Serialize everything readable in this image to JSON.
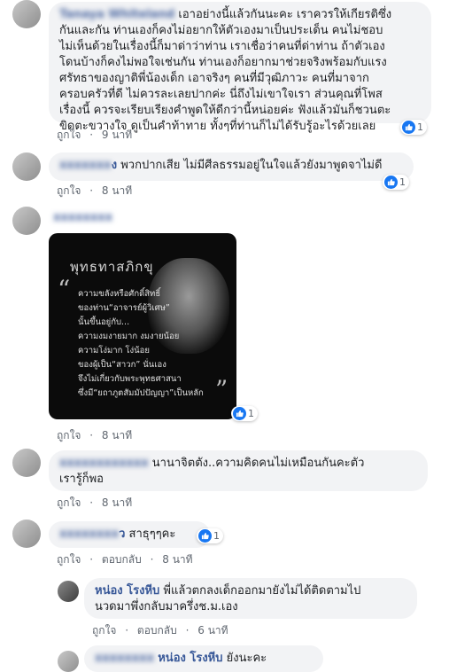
{
  "comments": [
    {
      "name": "Tanaya Whiteland",
      "lines": [
        "เอาอย่างนี้แล้วกันนะคะ เราควรให้เกียรติซึ่ง",
        "กันและกัน ท่านเองก็คงไม่อยากให้ตัวเองมาเป็นประเด็น คนไม่ชอบ",
        "ไม่เห็นด้วยในเรื่องนี้ก็มาด่าว่าท่าน เราเชื่อว่าคนที่ด่าท่าน ถ้าตัวเอง",
        "โดนบ้างก็คงไม่พอใจเช่นกัน ท่านเองก็อยากมาช่วยจริงพร้อมกับแรง",
        "ศรัทธาของญาติพี่น้องเด็ก เอาจริงๆ คนที่มีวุฒิภาวะ คนที่มาจาก",
        "ครอบครัวที่ดี ไม่ควรละเลยปากค่ะ นี่ถึงไม่เขาใจเรา ส่วนคุณที่โพส",
        "เรื่องนี้ ควรจะเรียบเรียงคำพูดให้ดีกว่านี้หน่อยค่ะ ฟังแล้วมันก็ชวนตะ",
        "ขิดตะขวางใจ ดูเป็นคำท้าทาย ทั้งๆที่ท่านก็ไม่ได้รับรู้อะไรด้วยเลย"
      ],
      "like_label": "ถูกใจ",
      "time": "9 นาที",
      "reaction_count": "1"
    },
    {
      "name": "xxxxxxx",
      "name_suffix": "ง",
      "lines": [
        "พวกปากเสีย ไม่มีศีลธรรมอยู่ในใจแล้วยังมาพูดจาไม่ดี"
      ],
      "like_label": "ถูกใจ",
      "time": "8 นาที",
      "reaction_count": "1"
    },
    {
      "name": "xxxxxxxx",
      "image": {
        "title": "พุทธทาสภิกขุ",
        "lines": [
          "ความขลังหรือศักดิ์สิทธิ์",
          "ของท่าน“อาจารย์ผู้วิเศษ”",
          "นั้นขึ้นอยู่กับ...",
          "ความงมงายมาก งมงายน้อย",
          "ความโง่มาก โง่น้อย",
          "ของผู้เป็น“สาวก” นั่นเอง",
          "จึงไม่เกี่ยวกับพระพุทธศาสนา",
          "ซึ่งมี“ยถาภูตสัมมัปปัญญา”เป็นหลัก"
        ]
      },
      "like_label": "ถูกใจ",
      "time": "8 นาที",
      "reaction_count": "1"
    },
    {
      "name": "xxxxxxxxxxxx",
      "lines": [
        "นานาจิตตัง..ความคิดคนไม่เหมือนกันคะตัว",
        "เรารู้ก็พอ"
      ],
      "like_label": "ถูกใจ",
      "time": "8 นาที"
    },
    {
      "name": "xxxxxxxx",
      "name_suffix": "ว",
      "lines": [
        "สาธุๆๆคะ"
      ],
      "like_label": "ถูกใจ",
      "reply_label": "ตอบกลับ",
      "time": "8 นาที",
      "reaction_count": "1"
    },
    {
      "name": "หน่อง โรงหีบ",
      "lines": [
        "พี่แล้วตกลงเด็กออกมายังไม่ได้ติดตามไป",
        "นวดมาพึ่งกลับมาครึ่งช.ม.เอง"
      ],
      "like_label": "ถูกใจ",
      "reply_label": "ตอบกลับ",
      "time": "6 นาที"
    },
    {
      "name": "xxxxxxxx",
      "mention": "หน่อง โรงหีบ",
      "lines": [
        "ยังนะคะ"
      ]
    }
  ]
}
